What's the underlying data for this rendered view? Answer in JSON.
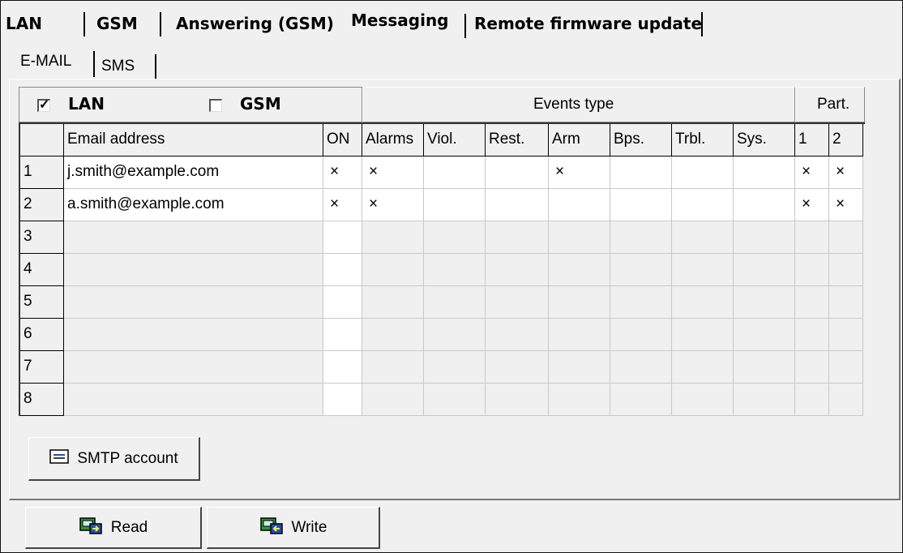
{
  "top_tabs": [
    {
      "label": "LAN"
    },
    {
      "label": "GSM"
    },
    {
      "label": "Answering (GSM)"
    },
    {
      "label": "Messaging",
      "active": true
    },
    {
      "label": "Remote firmware update"
    }
  ],
  "sub_tabs": [
    {
      "label": "E-MAIL",
      "active": true
    },
    {
      "label": "SMS"
    }
  ],
  "channels": {
    "lan": {
      "label": "LAN",
      "checked": true,
      "check_glyph": "✓"
    },
    "gsm": {
      "label": "GSM",
      "checked": false,
      "check_glyph": ""
    }
  },
  "groups": {
    "events_type": "Events type",
    "partitions": "Part."
  },
  "table": {
    "columns": [
      "",
      "Email address",
      "ON",
      "Alarms",
      "Viol.",
      "Rest.",
      "Arm",
      "Bps.",
      "Trbl.",
      "Sys.",
      "1",
      "2"
    ],
    "mark_glyph": "×",
    "rows": [
      {
        "num": "1",
        "email": "j.smith@example.com",
        "on": true,
        "alarms": true,
        "viol": false,
        "rest": false,
        "arm": true,
        "bps": false,
        "trbl": false,
        "sys": false,
        "p1": true,
        "p2": true
      },
      {
        "num": "2",
        "email": "a.smith@example.com",
        "on": true,
        "alarms": true,
        "viol": false,
        "rest": false,
        "arm": false,
        "bps": false,
        "trbl": false,
        "sys": false,
        "p1": true,
        "p2": true
      },
      {
        "num": "3",
        "email": "",
        "on": false,
        "alarms": false,
        "viol": false,
        "rest": false,
        "arm": false,
        "bps": false,
        "trbl": false,
        "sys": false,
        "p1": false,
        "p2": false
      },
      {
        "num": "4",
        "email": "",
        "on": false,
        "alarms": false,
        "viol": false,
        "rest": false,
        "arm": false,
        "bps": false,
        "trbl": false,
        "sys": false,
        "p1": false,
        "p2": false
      },
      {
        "num": "5",
        "email": "",
        "on": false,
        "alarms": false,
        "viol": false,
        "rest": false,
        "arm": false,
        "bps": false,
        "trbl": false,
        "sys": false,
        "p1": false,
        "p2": false
      },
      {
        "num": "6",
        "email": "",
        "on": false,
        "alarms": false,
        "viol": false,
        "rest": false,
        "arm": false,
        "bps": false,
        "trbl": false,
        "sys": false,
        "p1": false,
        "p2": false
      },
      {
        "num": "7",
        "email": "",
        "on": false,
        "alarms": false,
        "viol": false,
        "rest": false,
        "arm": false,
        "bps": false,
        "trbl": false,
        "sys": false,
        "p1": false,
        "p2": false
      },
      {
        "num": "8",
        "email": "",
        "on": false,
        "alarms": false,
        "viol": false,
        "rest": false,
        "arm": false,
        "bps": false,
        "trbl": false,
        "sys": false,
        "p1": false,
        "p2": false
      }
    ]
  },
  "buttons": {
    "smtp": {
      "label": "SMTP account",
      "icon": "envelope-icon"
    },
    "read": {
      "label": "Read",
      "icon": "read-device-icon"
    },
    "write": {
      "label": "Write",
      "icon": "write-device-icon"
    }
  },
  "colors": {
    "panel_bg": "#f0f0f0",
    "cell_white": "#ffffff",
    "icon_green": "#2a9d2a",
    "icon_blue": "#1f4fb8"
  }
}
